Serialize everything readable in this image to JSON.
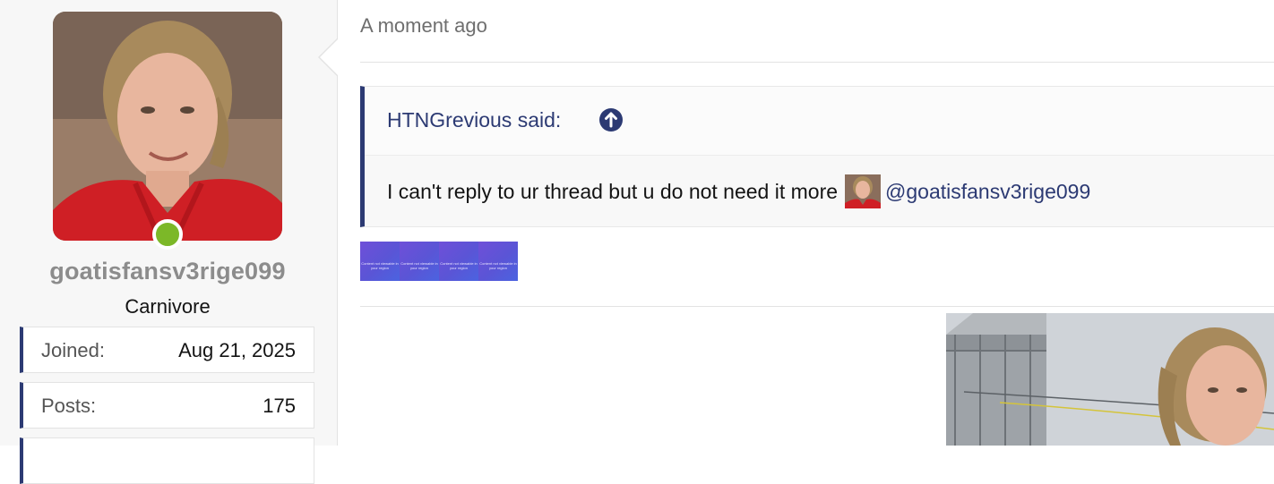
{
  "user": {
    "username": "goatisfansv3rige099",
    "title": "Carnivore",
    "online": true,
    "stats": [
      {
        "label": "Joined:",
        "value": "Aug 21, 2025"
      },
      {
        "label": "Posts:",
        "value": "175"
      }
    ]
  },
  "post": {
    "timestamp": "A moment ago",
    "quote": {
      "author": "HTNGrevious said:",
      "text": "I can't reply to ur thread but u do not need it more",
      "mention": "@goatisfansv3rige099"
    },
    "blocked_media": {
      "label": "Content not viewable in your region",
      "count": 4
    }
  },
  "colors": {
    "accent": "#2c3a73",
    "online": "#7cb828",
    "blocked_tile": "#5a55d6"
  },
  "icons": {
    "quote_jump": "arrow-up-circle-icon",
    "online_status": "online-dot-icon"
  }
}
